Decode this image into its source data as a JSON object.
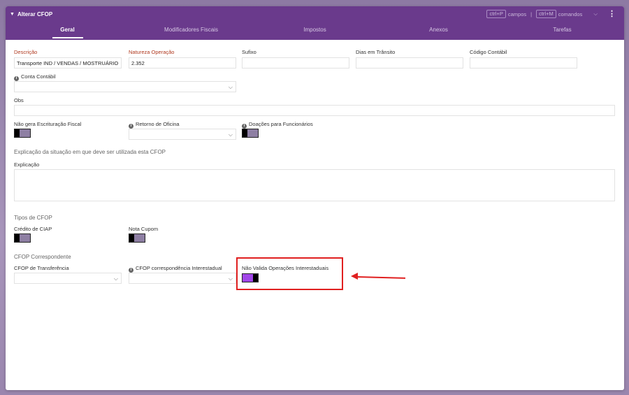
{
  "header": {
    "title": "Alterar CFOP",
    "shortcut_fields_key": "ctrl+P",
    "shortcut_fields_label": "campos",
    "shortcut_separator": "|",
    "shortcut_commands_key": "ctrl+M",
    "shortcut_commands_label": "comandos"
  },
  "tabs": [
    {
      "label": "Geral",
      "active": true
    },
    {
      "label": "Modificadores Fiscais"
    },
    {
      "label": "Impostos"
    },
    {
      "label": "Anexos"
    },
    {
      "label": "Tarefas"
    }
  ],
  "form": {
    "descricao_label": "Descrição",
    "descricao_value": "Transporte IND / VENDAS / MOSTRUÁRIO",
    "natureza_label": "Natureza Operação",
    "natureza_value": "2.352",
    "sufixo_label": "Sufixo",
    "dias_label": "Dias em Trânsito",
    "codigo_label": "Código Contábil",
    "conta_label": "Conta Contábil",
    "obs_label": "Obs",
    "nao_gera_label": "Não gera Escrituração Fiscal",
    "retorno_label": "Retorno de Oficina",
    "doacoes_label": "Doações para Funcionários",
    "explicacao_section": "Explicação da situação em que deve ser utilizada esta CFOP",
    "explicacao_label": "Explicação",
    "tipos_section": "Tipos de CFOP",
    "credito_label": "Crédito de CIAP",
    "nota_label": "Nota Cupom",
    "corresp_section": "CFOP Correspondente",
    "transferencia_label": "CFOP de Transferência",
    "interestadual_label": "CFOP correspondência Interestadual",
    "nao_valida_label": "Não Valida Operações Interestaduais"
  },
  "toggles": {
    "nao_gera": false,
    "doacoes": false,
    "credito": false,
    "nota": false,
    "nao_valida": true
  },
  "colors": {
    "header": "#6a3a8c",
    "toggle_on": "#a146e8",
    "highlight": "#e02020",
    "required_label": "#b03a20"
  }
}
